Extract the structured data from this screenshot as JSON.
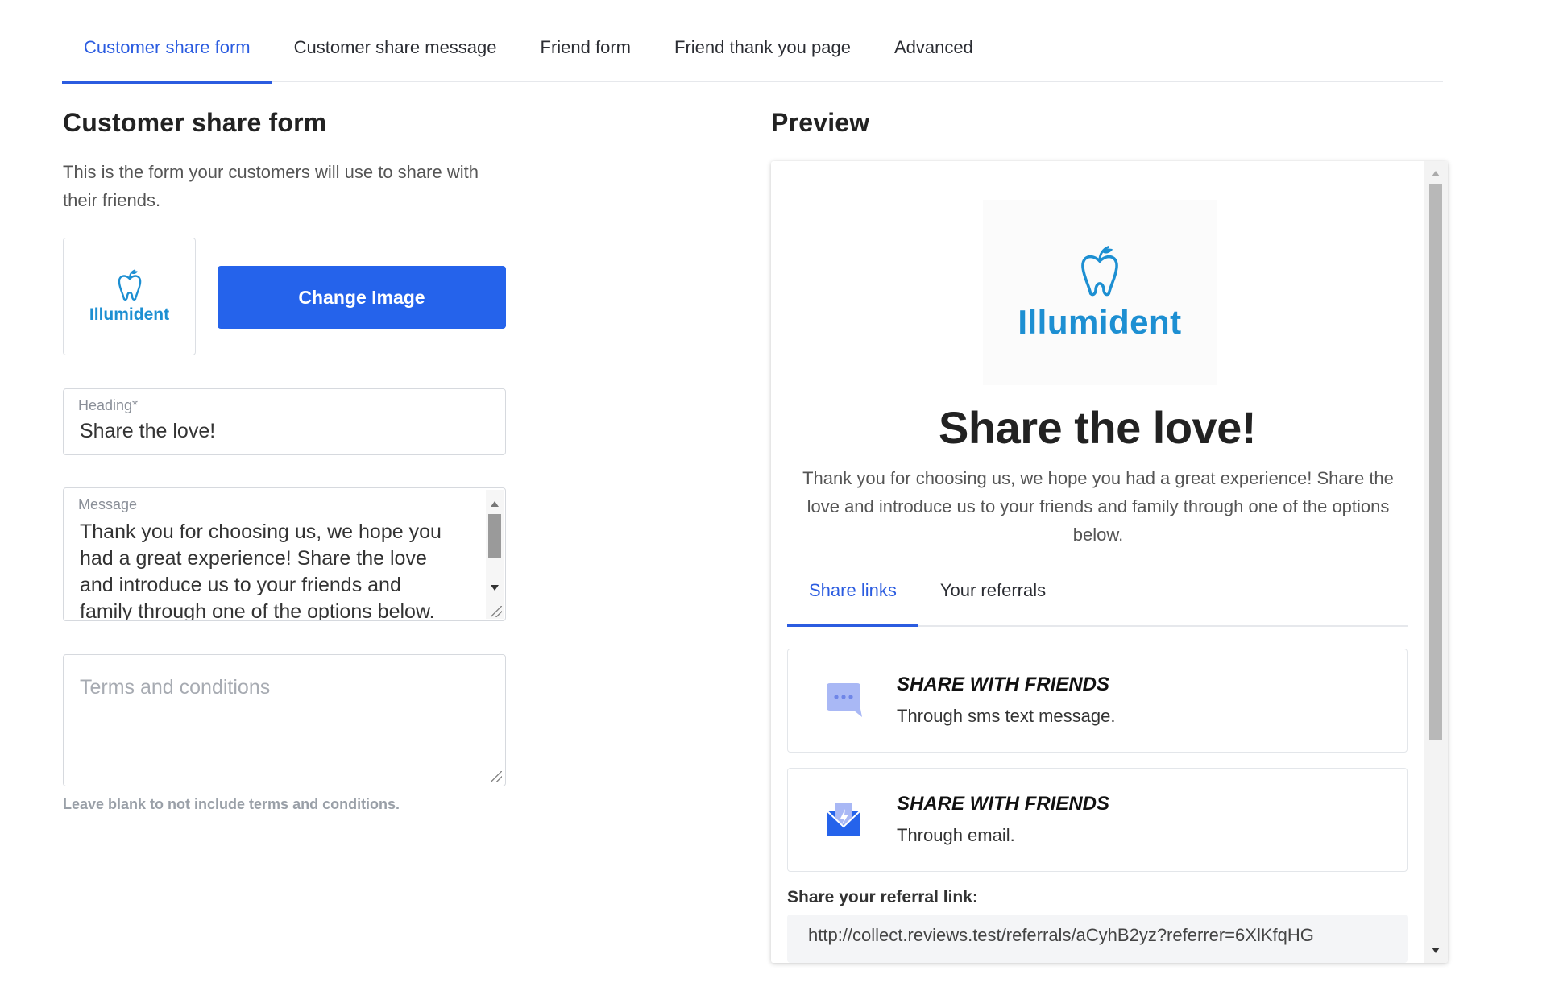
{
  "tabs": [
    {
      "label": "Customer share form",
      "active": true
    },
    {
      "label": "Customer share message",
      "active": false
    },
    {
      "label": "Friend form",
      "active": false
    },
    {
      "label": "Friend thank you page",
      "active": false
    },
    {
      "label": "Advanced",
      "active": false
    }
  ],
  "form": {
    "title": "Customer share form",
    "description": "This is the form your customers will use to share with their friends.",
    "logo": {
      "brand": "Illumident",
      "icon": "tooth-icon",
      "color": "#1d8fd2"
    },
    "change_image_label": "Change Image",
    "heading": {
      "label": "Heading*",
      "value": "Share the love!"
    },
    "message": {
      "label": "Message",
      "value": "Thank you for choosing us, we hope you had a great experience! Share the love and introduce us to your friends and family through one of the options below."
    },
    "terms": {
      "placeholder": "Terms and conditions",
      "hint": "Leave blank to not include terms and conditions."
    }
  },
  "preview": {
    "title": "Preview",
    "brand": "Illumident",
    "heading": "Share the love!",
    "message": "Thank you for choosing us, we hope you had a great experience! Share the love and introduce us to your friends and family through one of the options below.",
    "tabs": [
      {
        "label": "Share links",
        "active": true
      },
      {
        "label": "Your referrals",
        "active": false
      }
    ],
    "share_options": [
      {
        "title": "SHARE WITH FRIENDS",
        "subtitle": "Through sms text message.",
        "icon": "chat-bubble-icon",
        "color": "#a9b8f5"
      },
      {
        "title": "SHARE WITH FRIENDS",
        "subtitle": "Through email.",
        "icon": "email-icon",
        "color": "#2563eb"
      }
    ],
    "referral_label": "Share your referral link:",
    "referral_link": "http://collect.reviews.test/referrals/aCyhB2yz?referrer=6XlKfqHG"
  },
  "colors": {
    "accent": "#2b5ce0",
    "primary_button": "#2563eb",
    "brand": "#1d8fd2"
  }
}
